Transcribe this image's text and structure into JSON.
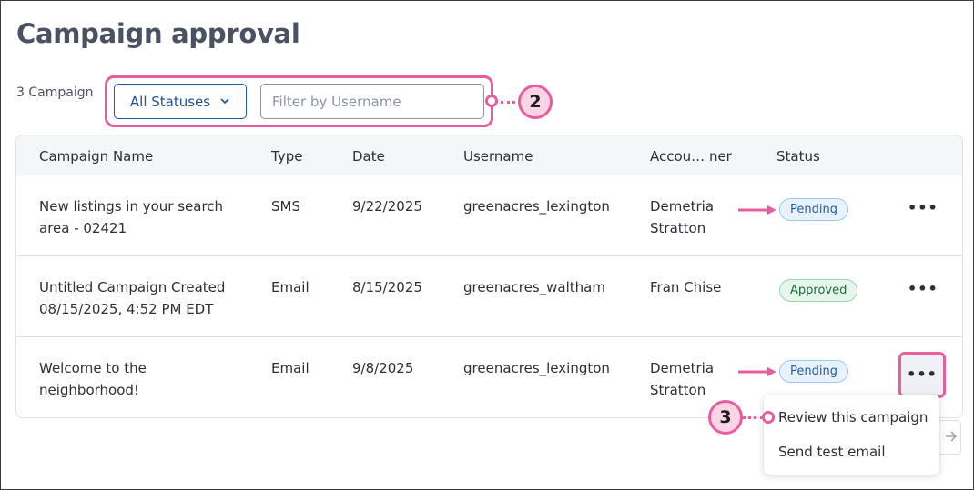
{
  "header": {
    "title": "Campaign approval",
    "count_label": "3 Campaign"
  },
  "filters": {
    "status_select_label": "All Statuses",
    "username_placeholder": "Filter by Username"
  },
  "callouts": {
    "filters_step": "2",
    "menu_step": "3"
  },
  "table": {
    "columns": [
      "Campaign Name",
      "Type",
      "Date",
      "Username",
      "Accou… ner",
      "Status"
    ],
    "rows": [
      {
        "name_line1": "New listings in your search",
        "name_line2": "area - 02421",
        "type": "SMS",
        "date": "9/22/2025",
        "username": "greenacres_lexington",
        "owner_line1": "Demetria",
        "owner_line2": "Stratton",
        "status": "Pending",
        "actions": "•••"
      },
      {
        "name_line1": "Untitled Campaign Created",
        "name_line2": "08/15/2025, 4:52 PM EDT",
        "type": "Email",
        "date": "8/15/2025",
        "username": "greenacres_waltham",
        "owner_line1": "Fran Chise",
        "owner_line2": "",
        "status": "Approved",
        "actions": "•••"
      },
      {
        "name_line1": "Welcome to the",
        "name_line2": "neighborhood!",
        "type": "Email",
        "date": "9/8/2025",
        "username": "greenacres_lexington",
        "owner_line1": "Demetria",
        "owner_line2": "Stratton",
        "status": "Pending",
        "actions": "•••"
      }
    ]
  },
  "row_menu": {
    "items": [
      "Review this campaign",
      "Send test email"
    ]
  },
  "colors": {
    "accent": "#e85d9e",
    "primary": "#1f5fa8",
    "pending": "#e8f2fd",
    "approved": "#e6f6ec"
  },
  "icons": {
    "select_caret": "chevron-down-icon",
    "row_actions": "ellipsis-icon",
    "pager_next": "arrow-right-icon",
    "annotation_arrow": "pink-arrow-icon"
  }
}
